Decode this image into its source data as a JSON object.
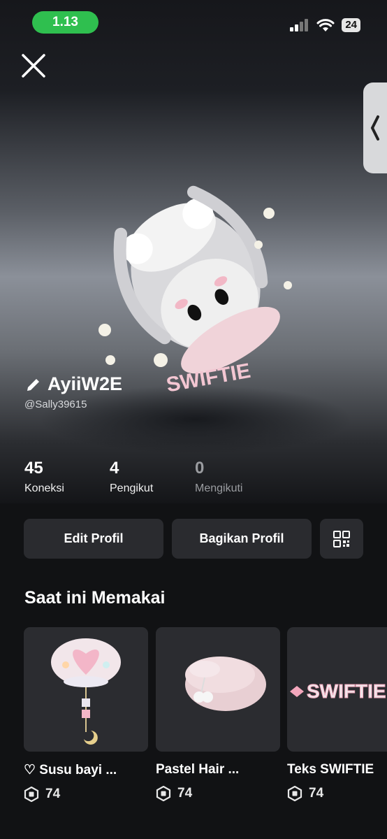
{
  "status_bar": {
    "time": "1.13",
    "battery": "24"
  },
  "profile": {
    "display_name": "AyiiW2E",
    "handle": "@Sally39615",
    "avatar_text": "SWIFTIE"
  },
  "stats": [
    {
      "value": "45",
      "label": "Koneksi"
    },
    {
      "value": "4",
      "label": "Pengikut"
    },
    {
      "value": "0",
      "label": "Mengikuti"
    }
  ],
  "actions": {
    "edit": "Edit Profil",
    "share": "Bagikan Profil"
  },
  "section": {
    "title": "Saat ini Memakai"
  },
  "items": [
    {
      "name": "♡ Susu bayi ...",
      "price": "74"
    },
    {
      "name": "Pastel Hair ...",
      "price": "74"
    },
    {
      "name": "Teks SWIFTIE",
      "price": "74",
      "thumb_text": "SWIFTIE"
    }
  ]
}
